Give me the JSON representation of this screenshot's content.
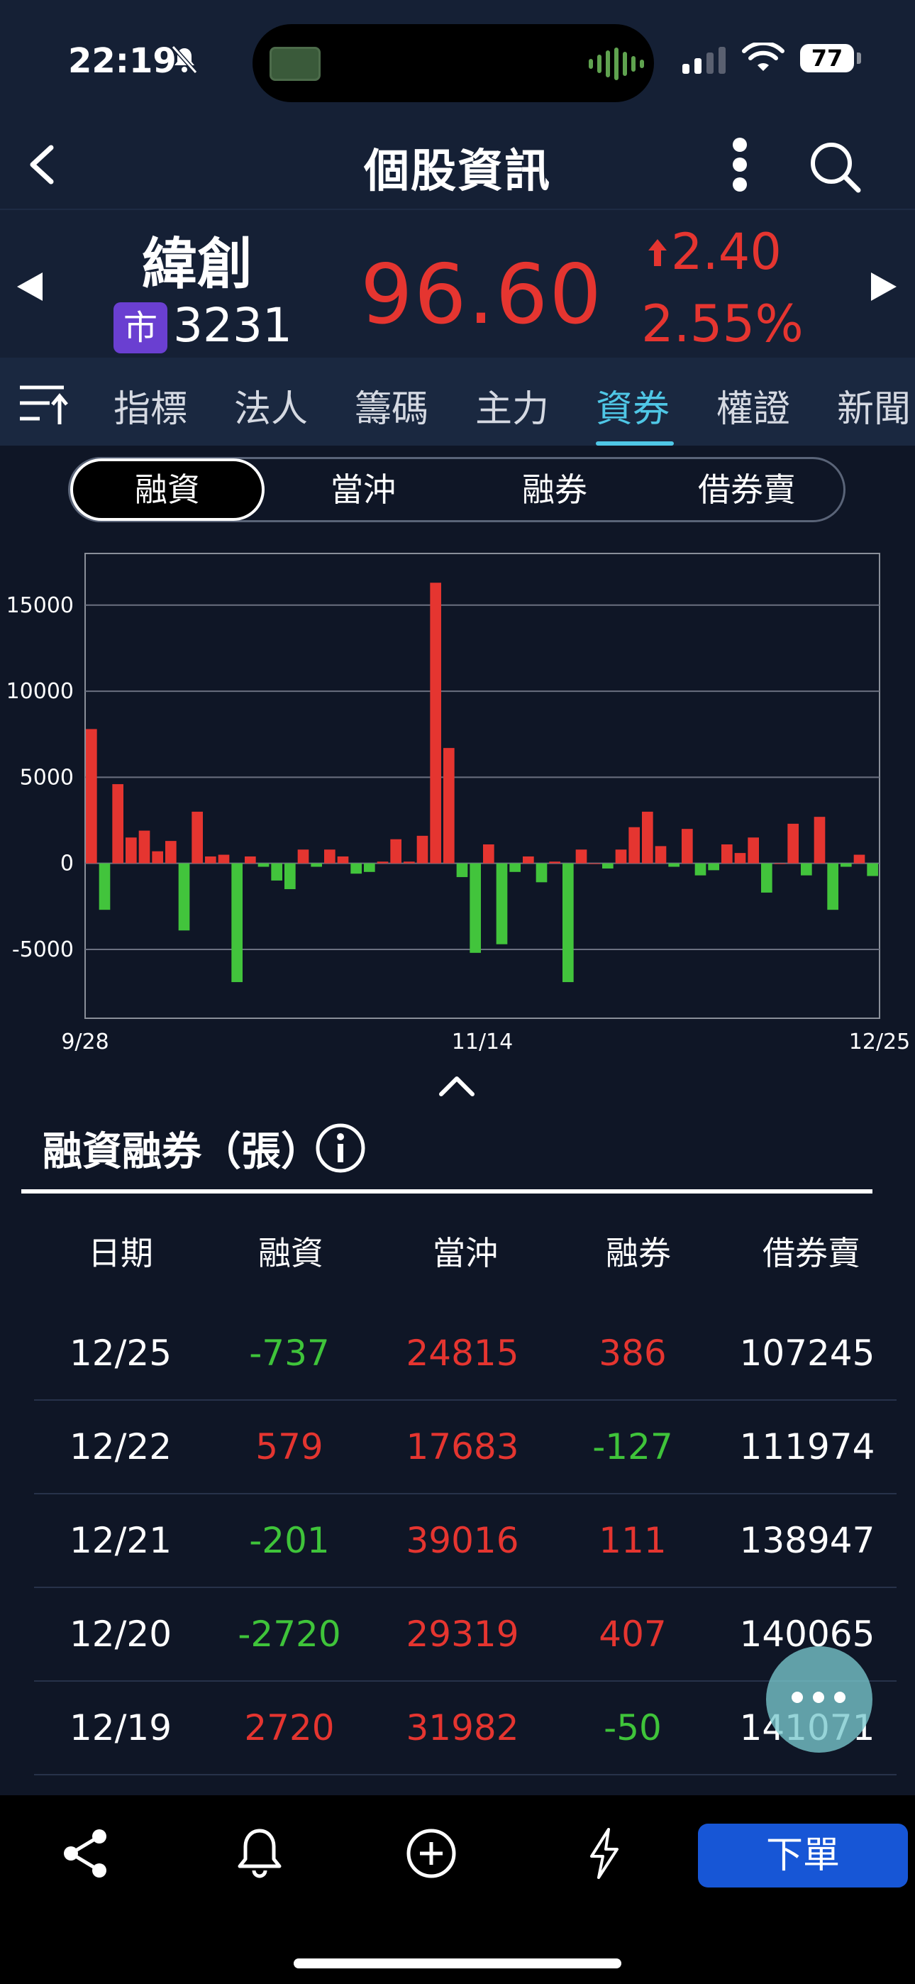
{
  "status_bar": {
    "time": "22:19",
    "battery": "77"
  },
  "header": {
    "title": "個股資訊"
  },
  "stock": {
    "name": "緯創",
    "market_badge": "市",
    "code": "3231",
    "price": "96.60",
    "change": "2.40",
    "change_pct": "2.55%"
  },
  "tabs": [
    {
      "label": "指標"
    },
    {
      "label": "法人"
    },
    {
      "label": "籌碼"
    },
    {
      "label": "主力"
    },
    {
      "label": "資券",
      "active": true
    },
    {
      "label": "權證"
    },
    {
      "label": "新聞"
    }
  ],
  "segments": [
    "融資",
    "當沖",
    "融券",
    "借券賣"
  ],
  "chart_data": {
    "type": "bar",
    "x_tick_labels": [
      "9/28",
      "11/14",
      "12/25"
    ],
    "y_ticks": [
      15000,
      10000,
      5000,
      0,
      -5000
    ],
    "ylim": [
      -9000,
      18000
    ],
    "values": [
      7800,
      -2700,
      4600,
      1500,
      1900,
      700,
      1300,
      -3900,
      3000,
      400,
      500,
      -6900,
      400,
      -200,
      -1000,
      -1500,
      800,
      -200,
      800,
      400,
      -600,
      -500,
      100,
      1400,
      100,
      1600,
      16300,
      6700,
      -800,
      -5200,
      1100,
      -4700,
      -500,
      400,
      -1100,
      100,
      -6900,
      800,
      0,
      -300,
      800,
      2100,
      3000,
      1000,
      -200,
      2000,
      -700,
      -400,
      1100,
      600,
      1500,
      -1700,
      0,
      2300,
      -700,
      2700,
      -2700,
      -200,
      500,
      -737
    ],
    "colors": {
      "positive": "#e53530",
      "negative": "#42c43c"
    }
  },
  "section": {
    "title": "融資融券（張）"
  },
  "table": {
    "headers": [
      "日期",
      "融資",
      "當沖",
      "融券",
      "借券賣"
    ],
    "rows": [
      [
        "12/25",
        "-737",
        "24815",
        "386",
        "107245"
      ],
      [
        "12/22",
        "579",
        "17683",
        "-127",
        "111974"
      ],
      [
        "12/21",
        "-201",
        "39016",
        "111",
        "138947"
      ],
      [
        "12/20",
        "-2720",
        "29319",
        "407",
        "140065"
      ],
      [
        "12/19",
        "2720",
        "31982",
        "-50",
        "141071"
      ]
    ]
  },
  "bottom_bar": {
    "order_label": "下單"
  }
}
